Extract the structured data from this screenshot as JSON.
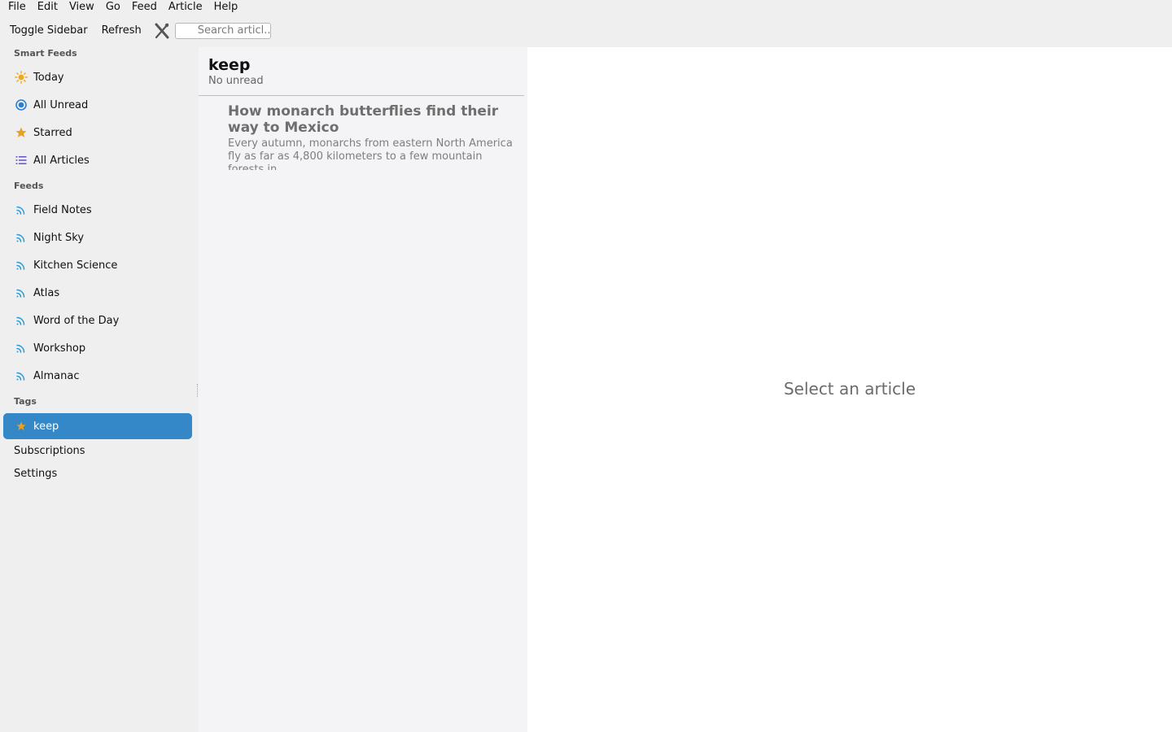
{
  "menu": [
    "File",
    "Edit",
    "View",
    "Go",
    "Feed",
    "Article",
    "Help"
  ],
  "toolbar": {
    "toggle_sidebar": "Toggle Sidebar",
    "refresh": "Refresh",
    "tools_icon": "tools-icon",
    "search_placeholder": "Search articl..."
  },
  "sidebar": {
    "smart_feeds_header": "Smart Feeds",
    "smart_feeds": [
      {
        "label": "Today",
        "icon": "sun-icon"
      },
      {
        "label": "All Unread",
        "icon": "unread-dot-icon"
      },
      {
        "label": "Starred",
        "icon": "star-icon"
      },
      {
        "label": "All Articles",
        "icon": "list-icon"
      }
    ],
    "feeds_header": "Feeds",
    "feeds": [
      {
        "label": "Field Notes",
        "icon": "rss-icon"
      },
      {
        "label": "Night Sky",
        "icon": "rss-icon"
      },
      {
        "label": "Kitchen Science",
        "icon": "rss-icon"
      },
      {
        "label": "Atlas",
        "icon": "rss-icon"
      },
      {
        "label": "Word of the Day",
        "icon": "rss-icon"
      },
      {
        "label": "Workshop",
        "icon": "rss-icon"
      },
      {
        "label": "Almanac",
        "icon": "rss-icon"
      }
    ],
    "tags_header": "Tags",
    "tags": [
      {
        "label": "keep",
        "icon": "star-icon",
        "selected": true
      }
    ],
    "subscriptions": "Subscriptions",
    "settings": "Settings"
  },
  "article_list": {
    "title": "keep",
    "subtitle": "No unread",
    "articles": [
      {
        "title": "How monarch butterflies find their way to Mexico",
        "snippet": "Every autumn, monarchs from eastern North America fly as far as 4,800 kilometers to a few mountain forests in"
      }
    ]
  },
  "reader": {
    "empty_text": "Select an article"
  },
  "colors": {
    "accent": "#3488c8",
    "star": "#e8a020",
    "sun": "#f0a818",
    "rss": "#2a9bd8",
    "list_icon": "#6a5ac8"
  }
}
